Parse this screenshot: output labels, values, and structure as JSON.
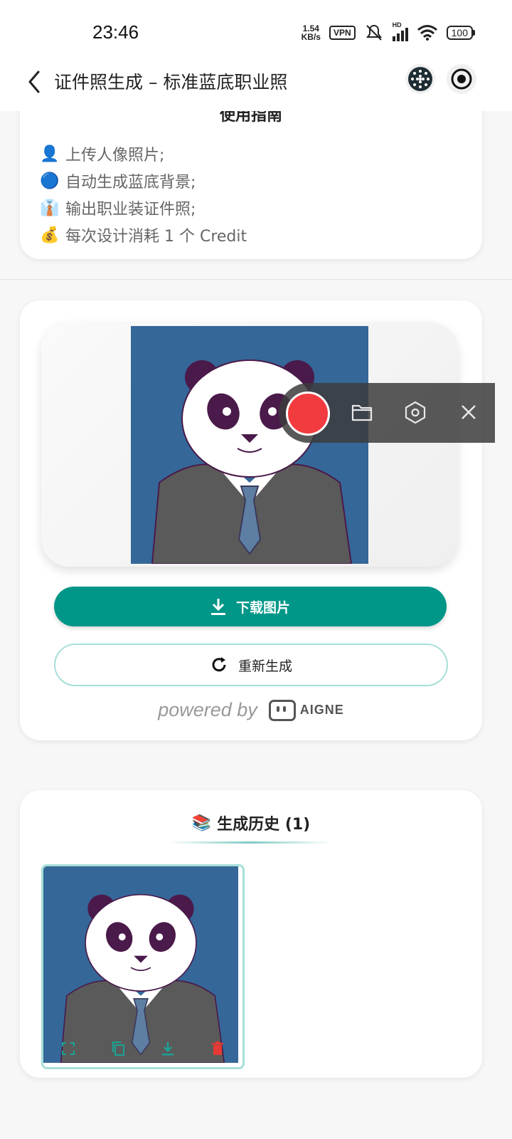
{
  "status": {
    "time": "23:46",
    "net_speed_top": "1.54",
    "net_speed_bottom": "KB/s",
    "vpn": "VPN",
    "hd": "HD",
    "battery": "100"
  },
  "header": {
    "title": "证件照生成 – 标准蓝底职业照"
  },
  "guide": {
    "heading": "使用指南",
    "items": [
      {
        "emoji": "👤",
        "text": "上传人像照片;"
      },
      {
        "emoji": "🔵",
        "text": "自动生成蓝底背景;"
      },
      {
        "emoji": "👔",
        "text": "输出职业装证件照;"
      },
      {
        "emoji": "💰",
        "text": "每次设计消耗 1 个 Credit"
      }
    ]
  },
  "result": {
    "download_label": "下载图片",
    "regenerate_label": "重新生成",
    "powered_by": "powered by",
    "brand": "AIGNE"
  },
  "history": {
    "emoji": "📚",
    "title": "生成历史 (1)"
  },
  "colors": {
    "accent": "#009688",
    "photo_bg": "#356798",
    "record": "#f23b3f",
    "delete": "#e53935"
  }
}
